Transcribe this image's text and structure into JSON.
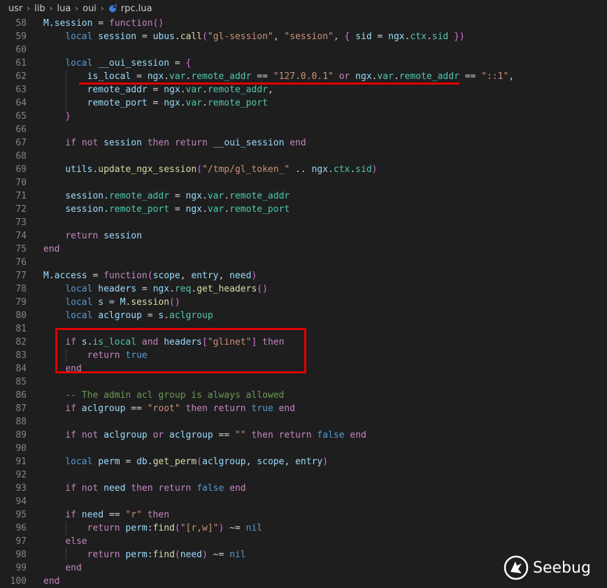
{
  "breadcrumb": {
    "items": [
      "usr",
      "lib",
      "lua",
      "oui"
    ],
    "file": "rpc.lua",
    "separator": "›"
  },
  "code_lines": [
    {
      "n": "58",
      "t": [
        [
          "id",
          "M"
        ],
        [
          "pu",
          "."
        ],
        [
          "id",
          "session"
        ],
        [
          "pu",
          " = "
        ],
        [
          "kw",
          "function"
        ],
        [
          "br",
          "()"
        ]
      ]
    },
    {
      "n": "59",
      "t": [
        [
          "pu",
          "    "
        ],
        [
          "kb",
          "local"
        ],
        [
          "pu",
          " "
        ],
        [
          "id",
          "session"
        ],
        [
          "pu",
          " = "
        ],
        [
          "id",
          "ubus"
        ],
        [
          "pu",
          "."
        ],
        [
          "fn",
          "call"
        ],
        [
          "br",
          "("
        ],
        [
          "str",
          "\"gl-session\""
        ],
        [
          "pu",
          ", "
        ],
        [
          "str",
          "\"session\""
        ],
        [
          "pu",
          ", "
        ],
        [
          "br",
          "{"
        ],
        [
          "pu",
          " "
        ],
        [
          "id",
          "sid"
        ],
        [
          "pu",
          " = "
        ],
        [
          "id",
          "ngx"
        ],
        [
          "pu",
          "."
        ],
        [
          "mem",
          "ctx"
        ],
        [
          "pu",
          "."
        ],
        [
          "mem",
          "sid"
        ],
        [
          "pu",
          " "
        ],
        [
          "br",
          "}"
        ],
        [
          "br",
          ")"
        ]
      ]
    },
    {
      "n": "60",
      "t": []
    },
    {
      "n": "61",
      "t": [
        [
          "pu",
          "    "
        ],
        [
          "kb",
          "local"
        ],
        [
          "pu",
          " "
        ],
        [
          "id",
          "__oui_session"
        ],
        [
          "pu",
          " = "
        ],
        [
          "br",
          "{"
        ]
      ]
    },
    {
      "n": "62",
      "t": [
        [
          "pu",
          "        "
        ],
        [
          "id",
          "is_local"
        ],
        [
          "pu",
          " = "
        ],
        [
          "id",
          "ngx"
        ],
        [
          "pu",
          "."
        ],
        [
          "mem",
          "var"
        ],
        [
          "pu",
          "."
        ],
        [
          "mem",
          "remote_addr"
        ],
        [
          "pu",
          " == "
        ],
        [
          "str",
          "\"127.0.0.1\""
        ],
        [
          "pu",
          " "
        ],
        [
          "kw",
          "or"
        ],
        [
          "pu",
          " "
        ],
        [
          "id",
          "ngx"
        ],
        [
          "pu",
          "."
        ],
        [
          "mem",
          "var"
        ],
        [
          "pu",
          "."
        ],
        [
          "mem",
          "remote_addr"
        ],
        [
          "pu",
          " == "
        ],
        [
          "str",
          "\"::1\""
        ],
        [
          "pu",
          ","
        ]
      ]
    },
    {
      "n": "63",
      "t": [
        [
          "pu",
          "        "
        ],
        [
          "id",
          "remote_addr"
        ],
        [
          "pu",
          " = "
        ],
        [
          "id",
          "ngx"
        ],
        [
          "pu",
          "."
        ],
        [
          "mem",
          "var"
        ],
        [
          "pu",
          "."
        ],
        [
          "mem",
          "remote_addr"
        ],
        [
          "pu",
          ","
        ]
      ]
    },
    {
      "n": "64",
      "t": [
        [
          "pu",
          "        "
        ],
        [
          "id",
          "remote_port"
        ],
        [
          "pu",
          " = "
        ],
        [
          "id",
          "ngx"
        ],
        [
          "pu",
          "."
        ],
        [
          "mem",
          "var"
        ],
        [
          "pu",
          "."
        ],
        [
          "mem",
          "remote_port"
        ]
      ]
    },
    {
      "n": "65",
      "t": [
        [
          "pu",
          "    "
        ],
        [
          "br",
          "}"
        ]
      ]
    },
    {
      "n": "66",
      "t": []
    },
    {
      "n": "67",
      "t": [
        [
          "pu",
          "    "
        ],
        [
          "kw",
          "if"
        ],
        [
          "pu",
          " "
        ],
        [
          "kw",
          "not"
        ],
        [
          "pu",
          " "
        ],
        [
          "id",
          "session"
        ],
        [
          "pu",
          " "
        ],
        [
          "kw",
          "then"
        ],
        [
          "pu",
          " "
        ],
        [
          "kw",
          "return"
        ],
        [
          "pu",
          " "
        ],
        [
          "id",
          "__oui_session"
        ],
        [
          "pu",
          " "
        ],
        [
          "kw",
          "end"
        ]
      ]
    },
    {
      "n": "68",
      "t": []
    },
    {
      "n": "69",
      "t": [
        [
          "pu",
          "    "
        ],
        [
          "id",
          "utils"
        ],
        [
          "pu",
          "."
        ],
        [
          "fn",
          "update_ngx_session"
        ],
        [
          "br",
          "("
        ],
        [
          "str",
          "\"/tmp/gl_token_\""
        ],
        [
          "pu",
          " .. "
        ],
        [
          "id",
          "ngx"
        ],
        [
          "pu",
          "."
        ],
        [
          "mem",
          "ctx"
        ],
        [
          "pu",
          "."
        ],
        [
          "mem",
          "sid"
        ],
        [
          "br",
          ")"
        ]
      ]
    },
    {
      "n": "70",
      "t": []
    },
    {
      "n": "71",
      "t": [
        [
          "pu",
          "    "
        ],
        [
          "id",
          "session"
        ],
        [
          "pu",
          "."
        ],
        [
          "mem",
          "remote_addr"
        ],
        [
          "pu",
          " = "
        ],
        [
          "id",
          "ngx"
        ],
        [
          "pu",
          "."
        ],
        [
          "mem",
          "var"
        ],
        [
          "pu",
          "."
        ],
        [
          "mem",
          "remote_addr"
        ]
      ]
    },
    {
      "n": "72",
      "t": [
        [
          "pu",
          "    "
        ],
        [
          "id",
          "session"
        ],
        [
          "pu",
          "."
        ],
        [
          "mem",
          "remote_port"
        ],
        [
          "pu",
          " = "
        ],
        [
          "id",
          "ngx"
        ],
        [
          "pu",
          "."
        ],
        [
          "mem",
          "var"
        ],
        [
          "pu",
          "."
        ],
        [
          "mem",
          "remote_port"
        ]
      ]
    },
    {
      "n": "73",
      "t": []
    },
    {
      "n": "74",
      "t": [
        [
          "pu",
          "    "
        ],
        [
          "kw",
          "return"
        ],
        [
          "pu",
          " "
        ],
        [
          "id",
          "session"
        ]
      ]
    },
    {
      "n": "75",
      "t": [
        [
          "kw",
          "end"
        ]
      ]
    },
    {
      "n": "76",
      "t": []
    },
    {
      "n": "77",
      "t": [
        [
          "id",
          "M"
        ],
        [
          "pu",
          "."
        ],
        [
          "id",
          "access"
        ],
        [
          "pu",
          " = "
        ],
        [
          "kw",
          "function"
        ],
        [
          "br",
          "("
        ],
        [
          "id",
          "scope"
        ],
        [
          "pu",
          ", "
        ],
        [
          "id",
          "entry"
        ],
        [
          "pu",
          ", "
        ],
        [
          "id",
          "need"
        ],
        [
          "br",
          ")"
        ]
      ]
    },
    {
      "n": "78",
      "t": [
        [
          "pu",
          "    "
        ],
        [
          "kb",
          "local"
        ],
        [
          "pu",
          " "
        ],
        [
          "id",
          "headers"
        ],
        [
          "pu",
          " = "
        ],
        [
          "id",
          "ngx"
        ],
        [
          "pu",
          "."
        ],
        [
          "mem",
          "req"
        ],
        [
          "pu",
          "."
        ],
        [
          "fn",
          "get_headers"
        ],
        [
          "br",
          "()"
        ]
      ]
    },
    {
      "n": "79",
      "t": [
        [
          "pu",
          "    "
        ],
        [
          "kb",
          "local"
        ],
        [
          "pu",
          " "
        ],
        [
          "id",
          "s"
        ],
        [
          "pu",
          " = "
        ],
        [
          "id",
          "M"
        ],
        [
          "pu",
          "."
        ],
        [
          "fn",
          "session"
        ],
        [
          "br",
          "()"
        ]
      ]
    },
    {
      "n": "80",
      "t": [
        [
          "pu",
          "    "
        ],
        [
          "kb",
          "local"
        ],
        [
          "pu",
          " "
        ],
        [
          "id",
          "aclgroup"
        ],
        [
          "pu",
          " = "
        ],
        [
          "id",
          "s"
        ],
        [
          "pu",
          "."
        ],
        [
          "mem",
          "aclgroup"
        ]
      ]
    },
    {
      "n": "81",
      "t": []
    },
    {
      "n": "82",
      "t": [
        [
          "pu",
          "    "
        ],
        [
          "kw",
          "if"
        ],
        [
          "pu",
          " "
        ],
        [
          "id",
          "s"
        ],
        [
          "pu",
          "."
        ],
        [
          "mem",
          "is_local"
        ],
        [
          "pu",
          " "
        ],
        [
          "kw",
          "and"
        ],
        [
          "pu",
          " "
        ],
        [
          "id",
          "headers"
        ],
        [
          "br",
          "["
        ],
        [
          "str",
          "\"glinet\""
        ],
        [
          "br",
          "]"
        ],
        [
          "pu",
          " "
        ],
        [
          "kw",
          "then"
        ]
      ]
    },
    {
      "n": "83",
      "t": [
        [
          "pu",
          "        "
        ],
        [
          "kw",
          "return"
        ],
        [
          "pu",
          " "
        ],
        [
          "kb",
          "true"
        ]
      ]
    },
    {
      "n": "84",
      "t": [
        [
          "pu",
          "    "
        ],
        [
          "kw",
          "end"
        ]
      ]
    },
    {
      "n": "85",
      "t": []
    },
    {
      "n": "86",
      "t": [
        [
          "pu",
          "    "
        ],
        [
          "cm",
          "-- The admin acl group is always allowed"
        ]
      ]
    },
    {
      "n": "87",
      "t": [
        [
          "pu",
          "    "
        ],
        [
          "kw",
          "if"
        ],
        [
          "pu",
          " "
        ],
        [
          "id",
          "aclgroup"
        ],
        [
          "pu",
          " == "
        ],
        [
          "str",
          "\"root\""
        ],
        [
          "pu",
          " "
        ],
        [
          "kw",
          "then"
        ],
        [
          "pu",
          " "
        ],
        [
          "kw",
          "return"
        ],
        [
          "pu",
          " "
        ],
        [
          "kb",
          "true"
        ],
        [
          "pu",
          " "
        ],
        [
          "kw",
          "end"
        ]
      ]
    },
    {
      "n": "88",
      "t": []
    },
    {
      "n": "89",
      "t": [
        [
          "pu",
          "    "
        ],
        [
          "kw",
          "if"
        ],
        [
          "pu",
          " "
        ],
        [
          "kw",
          "not"
        ],
        [
          "pu",
          " "
        ],
        [
          "id",
          "aclgroup"
        ],
        [
          "pu",
          " "
        ],
        [
          "kw",
          "or"
        ],
        [
          "pu",
          " "
        ],
        [
          "id",
          "aclgroup"
        ],
        [
          "pu",
          " == "
        ],
        [
          "str",
          "\"\""
        ],
        [
          "pu",
          " "
        ],
        [
          "kw",
          "then"
        ],
        [
          "pu",
          " "
        ],
        [
          "kw",
          "return"
        ],
        [
          "pu",
          " "
        ],
        [
          "kb",
          "false"
        ],
        [
          "pu",
          " "
        ],
        [
          "kw",
          "end"
        ]
      ]
    },
    {
      "n": "90",
      "t": []
    },
    {
      "n": "91",
      "t": [
        [
          "pu",
          "    "
        ],
        [
          "kb",
          "local"
        ],
        [
          "pu",
          " "
        ],
        [
          "id",
          "perm"
        ],
        [
          "pu",
          " = "
        ],
        [
          "id",
          "db"
        ],
        [
          "pu",
          "."
        ],
        [
          "fn",
          "get_perm"
        ],
        [
          "br",
          "("
        ],
        [
          "id",
          "aclgroup"
        ],
        [
          "pu",
          ", "
        ],
        [
          "id",
          "scope"
        ],
        [
          "pu",
          ", "
        ],
        [
          "id",
          "entry"
        ],
        [
          "br",
          ")"
        ]
      ]
    },
    {
      "n": "92",
      "t": []
    },
    {
      "n": "93",
      "t": [
        [
          "pu",
          "    "
        ],
        [
          "kw",
          "if"
        ],
        [
          "pu",
          " "
        ],
        [
          "kw",
          "not"
        ],
        [
          "pu",
          " "
        ],
        [
          "id",
          "need"
        ],
        [
          "pu",
          " "
        ],
        [
          "kw",
          "then"
        ],
        [
          "pu",
          " "
        ],
        [
          "kw",
          "return"
        ],
        [
          "pu",
          " "
        ],
        [
          "kb",
          "false"
        ],
        [
          "pu",
          " "
        ],
        [
          "kw",
          "end"
        ]
      ]
    },
    {
      "n": "94",
      "t": []
    },
    {
      "n": "95",
      "t": [
        [
          "pu",
          "    "
        ],
        [
          "kw",
          "if"
        ],
        [
          "pu",
          " "
        ],
        [
          "id",
          "need"
        ],
        [
          "pu",
          " == "
        ],
        [
          "str",
          "\"r\""
        ],
        [
          "pu",
          " "
        ],
        [
          "kw",
          "then"
        ]
      ]
    },
    {
      "n": "96",
      "t": [
        [
          "pu",
          "        "
        ],
        [
          "kw",
          "return"
        ],
        [
          "pu",
          " "
        ],
        [
          "id",
          "perm"
        ],
        [
          "pu",
          ":"
        ],
        [
          "fn",
          "find"
        ],
        [
          "br",
          "("
        ],
        [
          "str",
          "\"[r,w]\""
        ],
        [
          "br",
          ")"
        ],
        [
          "pu",
          " ~= "
        ],
        [
          "kb",
          "nil"
        ]
      ]
    },
    {
      "n": "97",
      "t": [
        [
          "pu",
          "    "
        ],
        [
          "kw",
          "else"
        ]
      ]
    },
    {
      "n": "98",
      "t": [
        [
          "pu",
          "        "
        ],
        [
          "kw",
          "return"
        ],
        [
          "pu",
          " "
        ],
        [
          "id",
          "perm"
        ],
        [
          "pu",
          ":"
        ],
        [
          "fn",
          "find"
        ],
        [
          "br",
          "("
        ],
        [
          "id",
          "need"
        ],
        [
          "br",
          ")"
        ],
        [
          "pu",
          " ~= "
        ],
        [
          "kb",
          "nil"
        ]
      ]
    },
    {
      "n": "99",
      "t": [
        [
          "pu",
          "    "
        ],
        [
          "kw",
          "end"
        ]
      ]
    },
    {
      "n": "100",
      "t": [
        [
          "kw",
          "end"
        ]
      ]
    }
  ],
  "watermark": {
    "text": "Seebug",
    "icon": "seebug-logo-icon"
  }
}
